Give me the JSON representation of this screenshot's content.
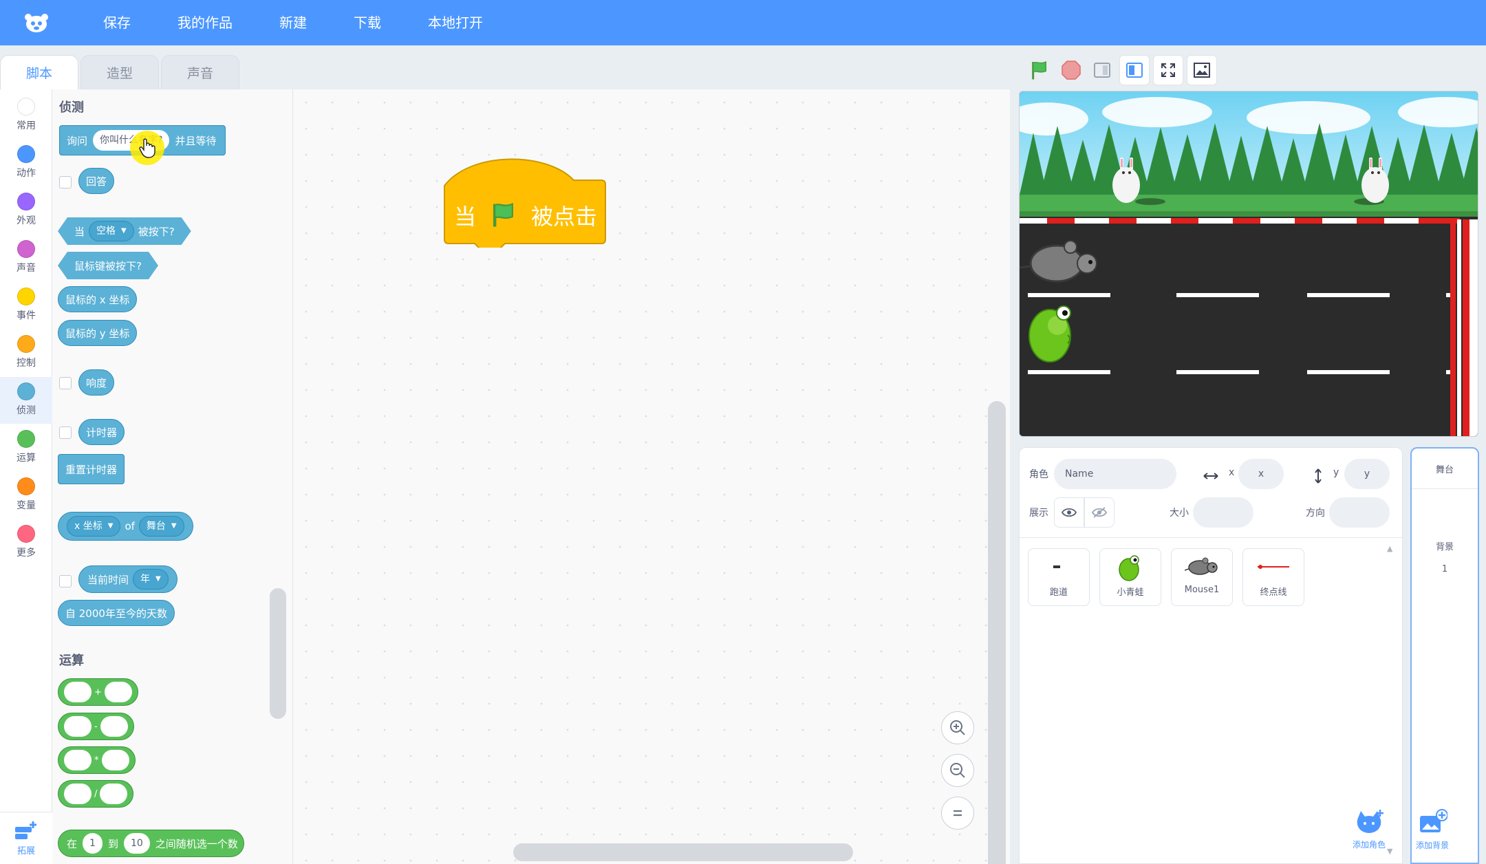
{
  "menu": {
    "items": [
      "保存",
      "我的作品",
      "新建",
      "下载",
      "本地打开"
    ]
  },
  "tabs": [
    {
      "label": "脚本",
      "active": true
    },
    {
      "label": "造型",
      "active": false
    },
    {
      "label": "声音",
      "active": false
    }
  ],
  "categories": [
    {
      "label": "常用",
      "color": "#ffffff"
    },
    {
      "label": "动作",
      "color": "#4c97ff"
    },
    {
      "label": "外观",
      "color": "#9966ff"
    },
    {
      "label": "声音",
      "color": "#cf63cf"
    },
    {
      "label": "事件",
      "color": "#ffd500"
    },
    {
      "label": "控制",
      "color": "#ffab19"
    },
    {
      "label": "侦测",
      "color": "#5cb1d6"
    },
    {
      "label": "运算",
      "color": "#59c059"
    },
    {
      "label": "变量",
      "color": "#ff8c1a"
    },
    {
      "label": "更多",
      "color": "#ff6680"
    }
  ],
  "extension_label": "拓展",
  "palette": {
    "sensing_title": "侦测",
    "ask": {
      "prefix": "询问",
      "input": "你叫什么名字?",
      "suffix": "并且等待"
    },
    "answer": "回答",
    "key_pressed": {
      "prefix": "当",
      "key": "空格",
      "suffix": "被按下?"
    },
    "mouse_down": "鼠标键被按下?",
    "mouse_x": "鼠标的 x 坐标",
    "mouse_y": "鼠标的 y 坐标",
    "loudness": "响度",
    "timer": "计时器",
    "reset_timer": "重置计时器",
    "of_block": {
      "prop": "x 坐标",
      "of": "of",
      "target": "舞台"
    },
    "current": {
      "label": "当前时间",
      "unit": "年"
    },
    "days_since": "自 2000年至今的天数",
    "operators_title": "运算",
    "op_add": "+",
    "op_sub": "-",
    "op_mul": "*",
    "op_div": "/",
    "random": {
      "prefix": "在",
      "from": "1",
      "to_word": "到",
      "to": "10",
      "suffix": "之间随机选一个数"
    }
  },
  "script": {
    "hat_prefix": "当",
    "hat_suffix": "被点击"
  },
  "sprite_info": {
    "sprite_label": "角色",
    "name_placeholder": "Name",
    "x_label": "x",
    "x_placeholder": "x",
    "y_label": "y",
    "y_placeholder": "y",
    "show_label": "展示",
    "size_label": "大小",
    "direction_label": "方向"
  },
  "sprites": [
    {
      "name": "跑道"
    },
    {
      "name": "小青蛙"
    },
    {
      "name": "Mouse1"
    },
    {
      "name": "终点线"
    }
  ],
  "add_sprite_label": "添加角色",
  "add_backdrop_label": "添加背景",
  "stage_panel": {
    "title": "舞台",
    "backdrops_label": "背景",
    "backdrops_count": "1"
  },
  "colors": {
    "brand": "#4c97ff",
    "events": "#ffbf00",
    "sensing": "#5cb1d6",
    "operators": "#59c059"
  }
}
